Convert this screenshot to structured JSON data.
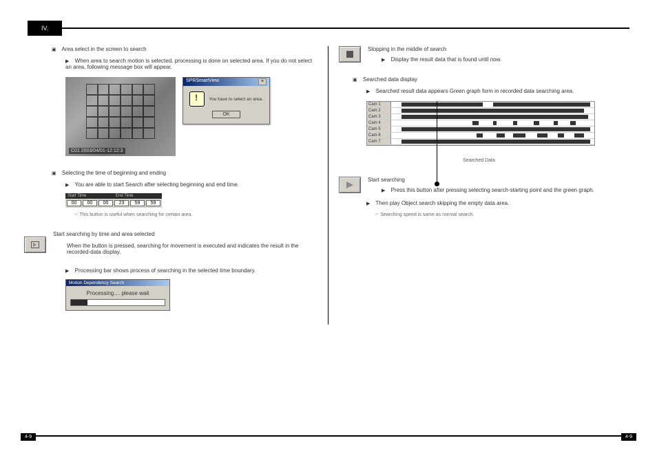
{
  "header": {
    "section_label": "IV."
  },
  "left": {
    "s1": {
      "title": "Area select in the screen to search",
      "body": "When area to search motion is selected, processing is done on selected area. If you do not select an area, following message box will appear."
    },
    "dialog": {
      "title": "SPRSmartView",
      "message": "You have to select an area.",
      "ok": "OK"
    },
    "cctv_label": "C01 2003/04/01-12:12:3",
    "s2": {
      "title": "Selecting the time of beginning and ending",
      "body": "You are able to start Search after selecting beginning and end time.",
      "note": "This button is useful when searching for certain area."
    },
    "time": {
      "start_label": "Start Time",
      "end_label": "End Time",
      "sh": "00",
      "sm": "00",
      "ss": "00",
      "eh": "23",
      "em": "59",
      "es": "59"
    },
    "s3": {
      "title": "Start searching by time and area selected",
      "body1": "When the button is pressed, searching for movement is executed and indicates the result in the recorded-data display.",
      "body2": "Processing bar shows process of searching in the selected time boundary."
    },
    "processing": {
      "title": "Motion Dependency Search",
      "text": "Processing.... please wait"
    }
  },
  "right": {
    "r1": {
      "title": "Stopping in the middle of search",
      "body": "Display the result data that is found until now."
    },
    "r2": {
      "title": "Searched data display",
      "body": "Searched result data appears Green graph form in recorded data searching area.",
      "caption": "Searched Data"
    },
    "timeline_rows": [
      "Cam 1",
      "Cam 2",
      "Cam 3",
      "Cam 4",
      "Cam 5",
      "Cam 6",
      "Cam 7"
    ],
    "r3": {
      "title": "Start searching",
      "body1": "Press this button after pressing selecting search-starting point and the green graph.",
      "body2": "Then play Object search skipping the empty data area.",
      "note": "Searching speed is same as normal search."
    }
  },
  "footer": {
    "left": "4-9",
    "right": "4-9"
  }
}
